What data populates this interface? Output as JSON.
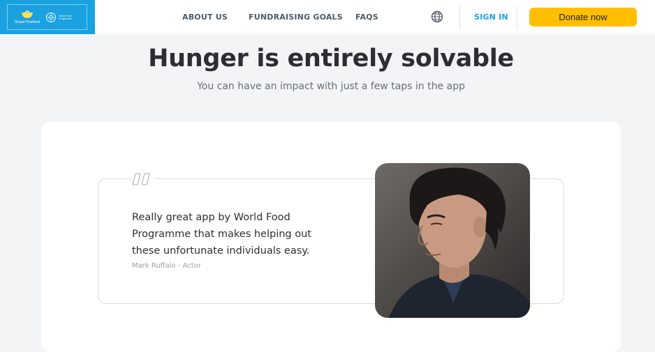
{
  "header": {
    "logo": {
      "brand_text": "ShareTheMeal",
      "partner_text": "World Food Programme",
      "brand_color": "#1aa1e0"
    },
    "nav": [
      {
        "label": "ABOUT US"
      },
      {
        "label": "FUNDRAISING GOALS"
      },
      {
        "label": "FAQS"
      }
    ],
    "language_icon": "globe-icon",
    "sign_in_label": "SIGN IN",
    "donate_label": "Donate now",
    "donate_color": "#ffbf00"
  },
  "hero": {
    "title": "Hunger is entirely solvable",
    "subtitle": "You can have an impact with just a few taps in the app"
  },
  "testimonial": {
    "quote_icon": "quote-icon",
    "quote": "Really great app by World Food Programme that makes helping out these unfortunate individuals easy.",
    "author": "Mark Ruffalo - Actor"
  }
}
